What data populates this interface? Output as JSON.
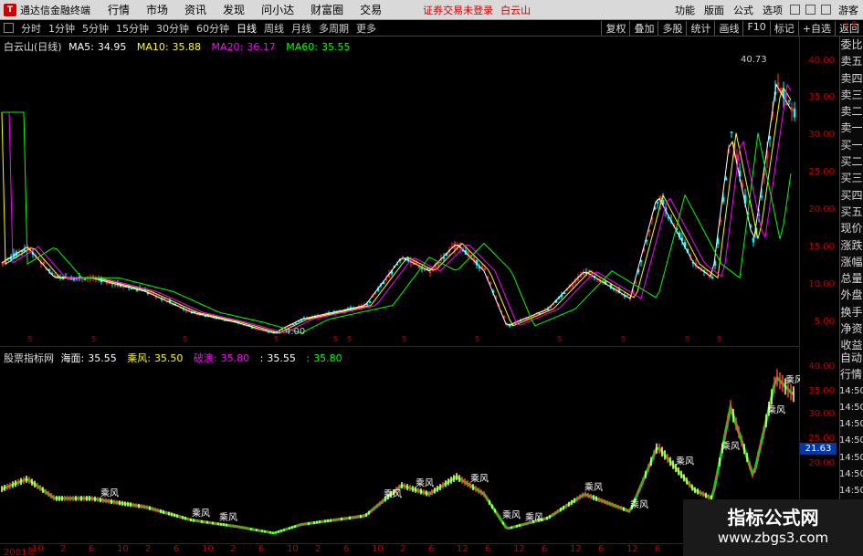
{
  "app": {
    "title": "通达信金融终端",
    "logo": "T",
    "notice": "证券交易未登录",
    "stock": "白云山"
  },
  "menu": [
    "行情",
    "市场",
    "资讯",
    "发现",
    "问小达",
    "财富圈",
    "交易"
  ],
  "topright": [
    "功能",
    "版面",
    "公式",
    "选项",
    "游客"
  ],
  "periods": [
    "分时",
    "1分钟",
    "5分钟",
    "15分钟",
    "30分钟",
    "60分钟",
    "日线",
    "周线",
    "月线",
    "多周期",
    "更多"
  ],
  "active_period": "日线",
  "toolbar_right": [
    "复权",
    "叠加",
    "多股",
    "统计",
    "画线",
    "F10",
    "标记",
    "+自选",
    "返回"
  ],
  "main": {
    "name": "白云山(日线)",
    "ma": [
      {
        "label": "MA5:",
        "value": "34.95",
        "color": "#ffffff"
      },
      {
        "label": "MA10:",
        "value": "35.88",
        "color": "#ffff00"
      },
      {
        "label": "MA20:",
        "value": "36.17",
        "color": "#ff00ff"
      },
      {
        "label": "MA60:",
        "value": "35.55",
        "color": "#00ff00"
      }
    ],
    "max_label": "40.73",
    "min_label": "4.00",
    "yticks": [
      "40.00",
      "35.00",
      "30.00",
      "25.00",
      "20.00",
      "15.00",
      "10.00",
      "5.00"
    ]
  },
  "sub": {
    "name": "股票指标网",
    "items": [
      {
        "label": "海面:",
        "value": "35.55",
        "color": "#ffffff"
      },
      {
        "label": "乘风:",
        "value": "35.50",
        "color": "#ffff00"
      },
      {
        "label": "破浪:",
        "value": "35.80",
        "color": "#ff00ff"
      },
      {
        "label": ":",
        "value": "35.55",
        "color": "#ffffff"
      },
      {
        "label": ":",
        "value": "35.80",
        "color": "#00ff00"
      }
    ],
    "yticks": [
      "40.00",
      "35.00",
      "30.00",
      "25.00",
      "20.00"
    ],
    "current": "21.63",
    "marker": "乘风"
  },
  "side": [
    "委比",
    "卖五",
    "卖四",
    "卖三",
    "卖二",
    "卖一",
    "买一",
    "买二",
    "买三",
    "买四",
    "买五",
    "现价",
    "涨跌",
    "涨幅",
    "总量",
    "外盘",
    "换手",
    "净资",
    "收益"
  ],
  "side2": [
    "自动",
    "行情",
    "14:50",
    "14:50",
    "14:50",
    "14:50",
    "14:50",
    "14:50",
    "14:50",
    "14:50",
    "14:50",
    "14:50"
  ],
  "sidebar_top": "L R",
  "timeaxis": [
    "2001年",
    "10",
    "2",
    "6",
    "10",
    "2",
    "6",
    "10",
    "2",
    "6",
    "10",
    "2",
    "6",
    "10",
    "2",
    "6",
    "12",
    "6",
    "12",
    "6",
    "12",
    "6",
    "12",
    "6",
    "12",
    "6",
    "12",
    "6"
  ],
  "watermark": {
    "line1": "指标公式网",
    "line2": "www.zbgs3.com"
  },
  "colors": {
    "up": "#ff3232",
    "down": "#00ffff",
    "ma5": "#ffffff",
    "ma10": "#ffff00",
    "ma20": "#ff00ff",
    "ma60": "#00ff00",
    "grid": "#8b0000"
  }
}
